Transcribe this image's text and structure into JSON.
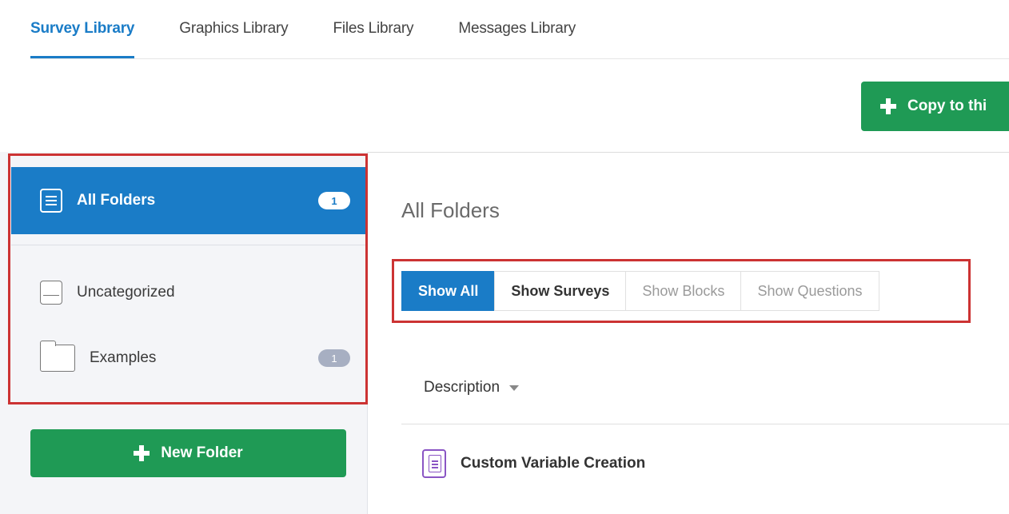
{
  "tabs": [
    {
      "label": "Survey Library",
      "active": true
    },
    {
      "label": "Graphics Library",
      "active": false
    },
    {
      "label": "Files Library",
      "active": false
    },
    {
      "label": "Messages Library",
      "active": false
    }
  ],
  "copy_button": {
    "label": "Copy to thi"
  },
  "sidebar": {
    "items": [
      {
        "label": "All Folders",
        "count": "1",
        "icon": "list-icon"
      },
      {
        "label": "Uncategorized",
        "count": "",
        "icon": "tray-icon"
      },
      {
        "label": "Examples",
        "count": "1",
        "icon": "folder-icon"
      }
    ],
    "new_folder_label": "New Folder"
  },
  "main": {
    "title": "All Folders",
    "filters": [
      {
        "label": "Show All",
        "state": "active"
      },
      {
        "label": "Show Surveys",
        "state": "enabled"
      },
      {
        "label": "Show Blocks",
        "state": "disabled"
      },
      {
        "label": "Show Questions",
        "state": "disabled"
      }
    ],
    "column_header": "Description",
    "rows": [
      {
        "title": "Custom Variable Creation",
        "icon": "survey-icon"
      }
    ]
  },
  "colors": {
    "accent": "#1a7cc7",
    "success": "#1f9a55",
    "highlight": "#cc3333",
    "survey_icon": "#8a55c4"
  }
}
